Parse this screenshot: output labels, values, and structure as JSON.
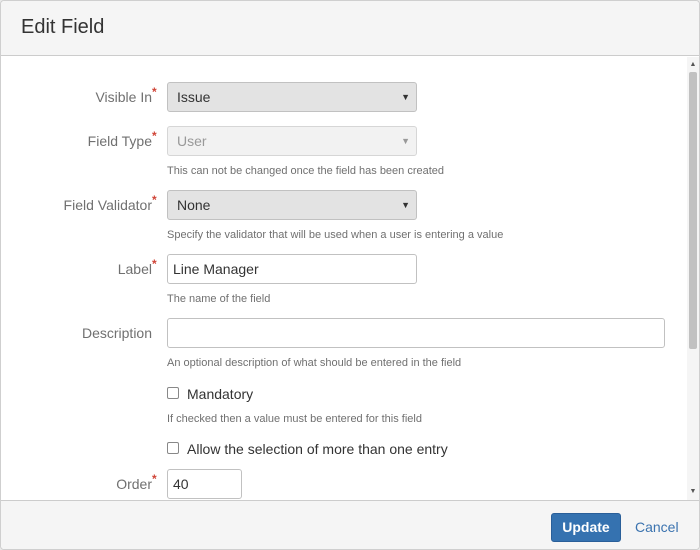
{
  "dialog": {
    "title": "Edit Field"
  },
  "form": {
    "visible_in": {
      "label": "Visible In",
      "required_mark": "*",
      "value": "Issue",
      "caret": "▼"
    },
    "field_type": {
      "label": "Field Type",
      "required_mark": "*",
      "value": "User",
      "caret": "▼",
      "help": "This can not be changed once the field has been created"
    },
    "field_validator": {
      "label": "Field Validator",
      "required_mark": "*",
      "value": "None",
      "caret": "▼",
      "help": "Specify the validator that will be used when a user is entering a value"
    },
    "label_field": {
      "label": "Label",
      "required_mark": "*",
      "value": "Line Manager",
      "help": "The name of the field"
    },
    "description": {
      "label": "Description",
      "value": "",
      "help": "An optional description of what should be entered in the field"
    },
    "mandatory": {
      "label": "Mandatory",
      "checked": false,
      "help": "If checked then a value must be entered for this field"
    },
    "multi_select": {
      "label": "Allow the selection of more than one entry",
      "checked": false
    },
    "order": {
      "label": "Order",
      "required_mark": "*",
      "value": "40"
    }
  },
  "scrollbar": {
    "up_arrow": "▲",
    "down_arrow": "▼"
  },
  "footer": {
    "update_label": "Update",
    "cancel_label": "Cancel"
  },
  "colors": {
    "primary": "#3572b0",
    "link": "#3b73af",
    "required": "#d04437"
  }
}
